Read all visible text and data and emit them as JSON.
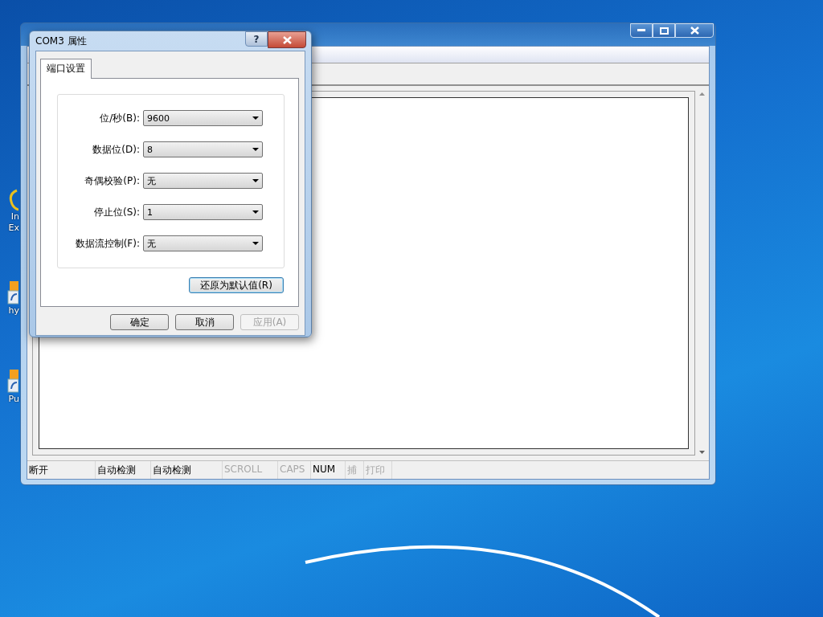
{
  "desktop": {
    "icons": [
      {
        "kind": "browser",
        "lines": [
          "In",
          "Ex"
        ]
      },
      {
        "kind": "shortcut",
        "lines": [
          "hy"
        ]
      },
      {
        "kind": "shortcut",
        "lines": [
          "Pu"
        ]
      }
    ]
  },
  "main_window": {
    "status_bar": [
      {
        "text": "断开",
        "disabled": false
      },
      {
        "text": "自动检测",
        "disabled": false
      },
      {
        "text": "自动检测",
        "disabled": false
      },
      {
        "text": "SCROLL",
        "disabled": true
      },
      {
        "text": "CAPS",
        "disabled": true
      },
      {
        "text": "NUM",
        "disabled": false
      },
      {
        "text": "捕",
        "disabled": true
      },
      {
        "text": "打印",
        "disabled": true
      }
    ]
  },
  "dialog": {
    "title": "COM3 属性",
    "help_button": "?",
    "tabs": [
      {
        "label": "端口设置",
        "selected": true
      }
    ],
    "fields": [
      {
        "label": "位/秒(B):",
        "value": "9600"
      },
      {
        "label": "数据位(D):",
        "value": "8"
      },
      {
        "label": "奇偶校验(P):",
        "value": "无"
      },
      {
        "label": "停止位(S):",
        "value": "1"
      },
      {
        "label": "数据流控制(F):",
        "value": "无"
      }
    ],
    "reset_button": "还原为默认值(R)",
    "buttons": [
      {
        "label": "确定",
        "disabled": false
      },
      {
        "label": "取消",
        "disabled": false
      },
      {
        "label": "应用(A)",
        "disabled": true
      }
    ]
  }
}
